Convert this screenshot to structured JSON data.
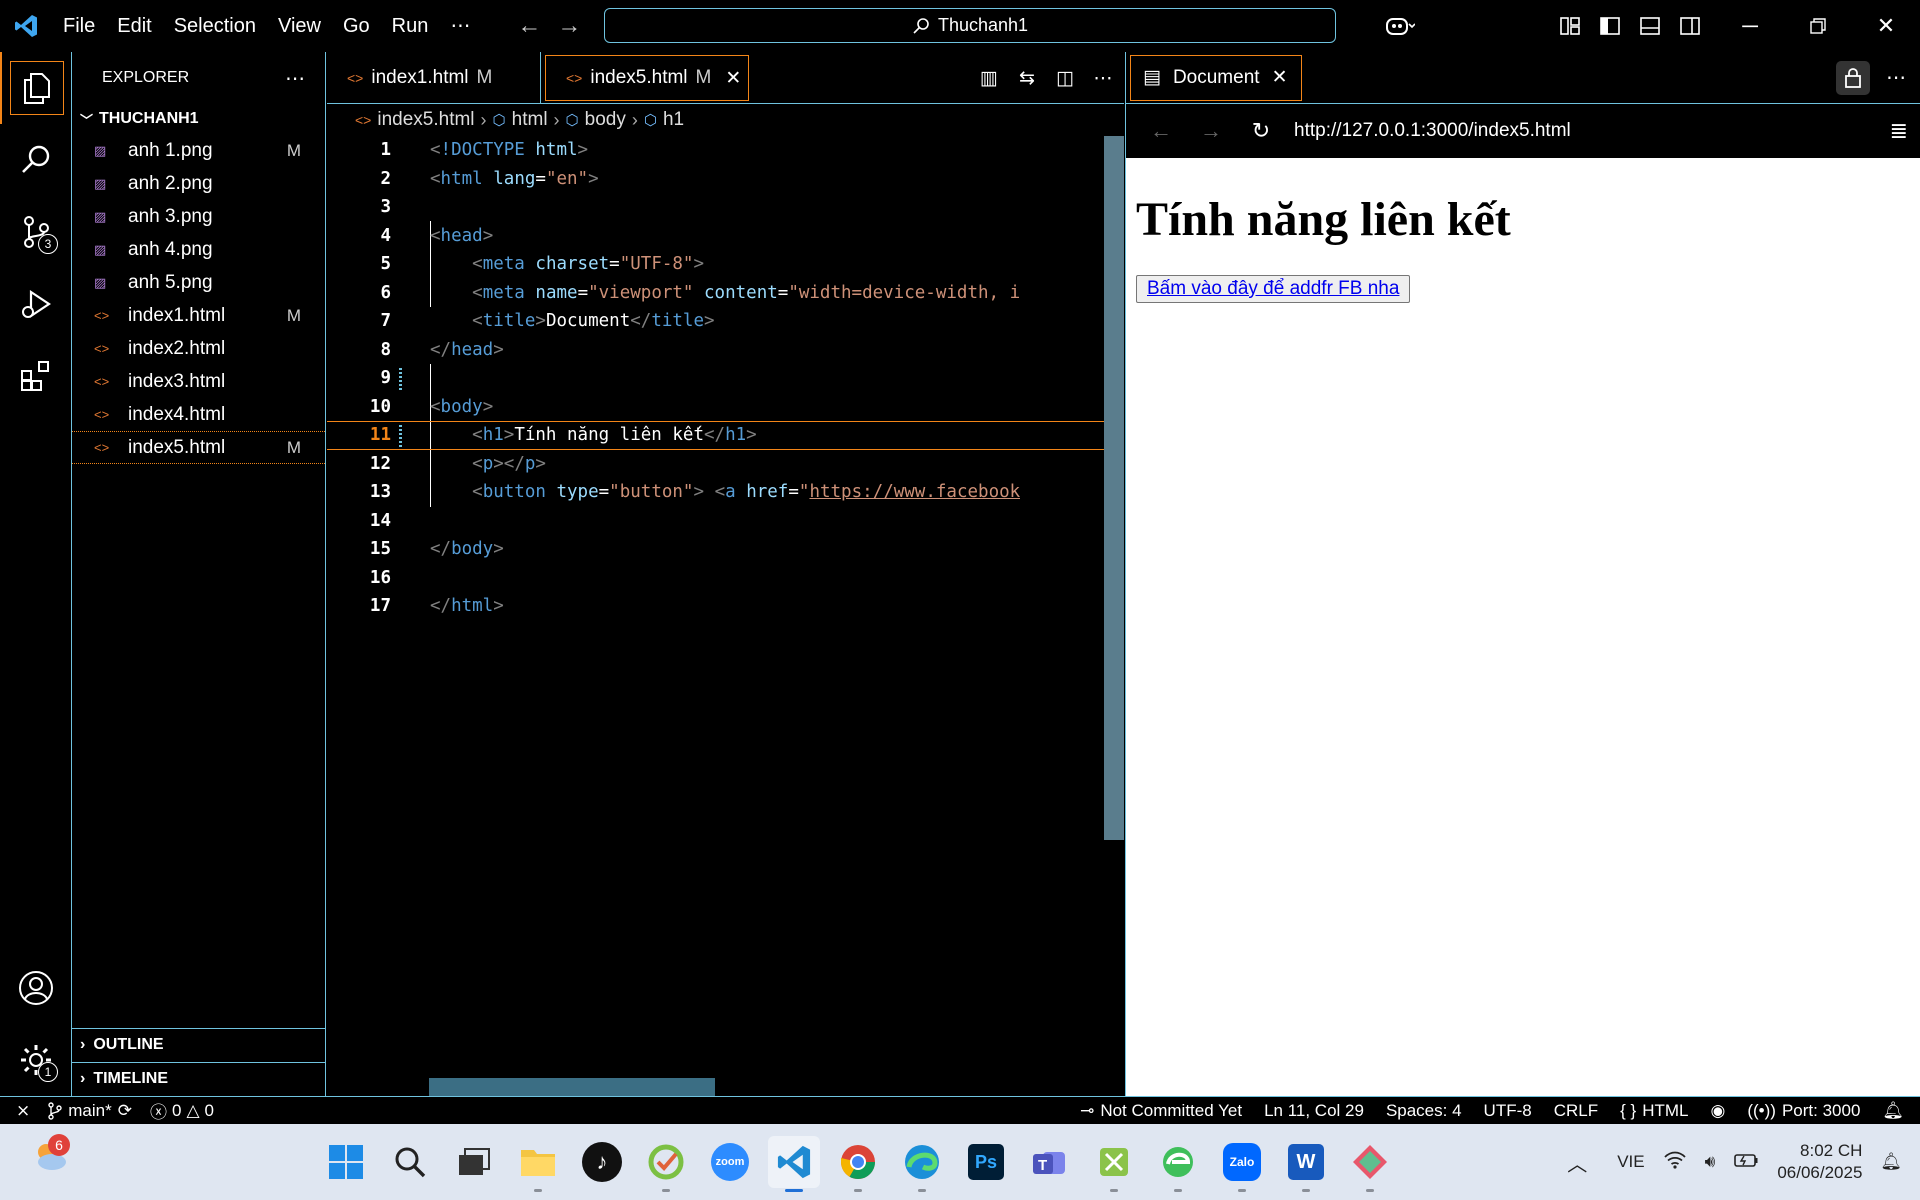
{
  "titlebar": {
    "menu": [
      "File",
      "Edit",
      "Selection",
      "View",
      "Go",
      "Run",
      "⋯"
    ],
    "search_text": "Thuchanh1"
  },
  "activity": {
    "scm_badge": "3",
    "settings_badge": "1"
  },
  "explorer": {
    "header": "EXPLORER",
    "folder": "THUCHANH1",
    "files": [
      {
        "name": "anh 1.png",
        "status": "M"
      },
      {
        "name": "anh 2.png",
        "status": ""
      },
      {
        "name": "anh 3.png",
        "status": ""
      },
      {
        "name": "anh 4.png",
        "status": ""
      },
      {
        "name": "anh 5.png",
        "status": ""
      },
      {
        "name": "index1.html",
        "status": "M"
      },
      {
        "name": "index2.html",
        "status": ""
      },
      {
        "name": "index3.html",
        "status": ""
      },
      {
        "name": "index4.html",
        "status": ""
      },
      {
        "name": "index5.html",
        "status": "M"
      }
    ],
    "outline": "OUTLINE",
    "timeline": "TIMELINE"
  },
  "editor": {
    "tabs": [
      {
        "label": "index1.html",
        "status": "M"
      },
      {
        "label": "index5.html",
        "status": "M"
      }
    ],
    "breadcrumb": [
      "index5.html",
      "html",
      "body",
      "h1"
    ],
    "line_numbers": [
      "1",
      "2",
      "3",
      "4",
      "5",
      "6",
      "7",
      "8",
      "9",
      "10",
      "11",
      "12",
      "13",
      "14",
      "15",
      "16",
      "17"
    ]
  },
  "preview": {
    "tab_label": "Document",
    "url": "http://127.0.0.1:3000/index5.html",
    "heading": "Tính năng liên kết",
    "button_link": "Bấm vào đây để addfr FB nha"
  },
  "statusbar": {
    "branch": "main*",
    "errors": "0",
    "warnings": "0",
    "commit": "Not Committed Yet",
    "position": "Ln 11, Col 29",
    "spaces": "Spaces: 4",
    "encoding": "UTF-8",
    "eol": "CRLF",
    "language": "HTML",
    "port": "Port: 3000"
  },
  "taskbar": {
    "weather_badge": "6",
    "zoom_label": "zoom",
    "ps_label": "Ps",
    "zalo_label": "Zalo",
    "word_label": "W",
    "lang": "VIE",
    "time": "8:02 CH",
    "date": "06/06/2025"
  }
}
